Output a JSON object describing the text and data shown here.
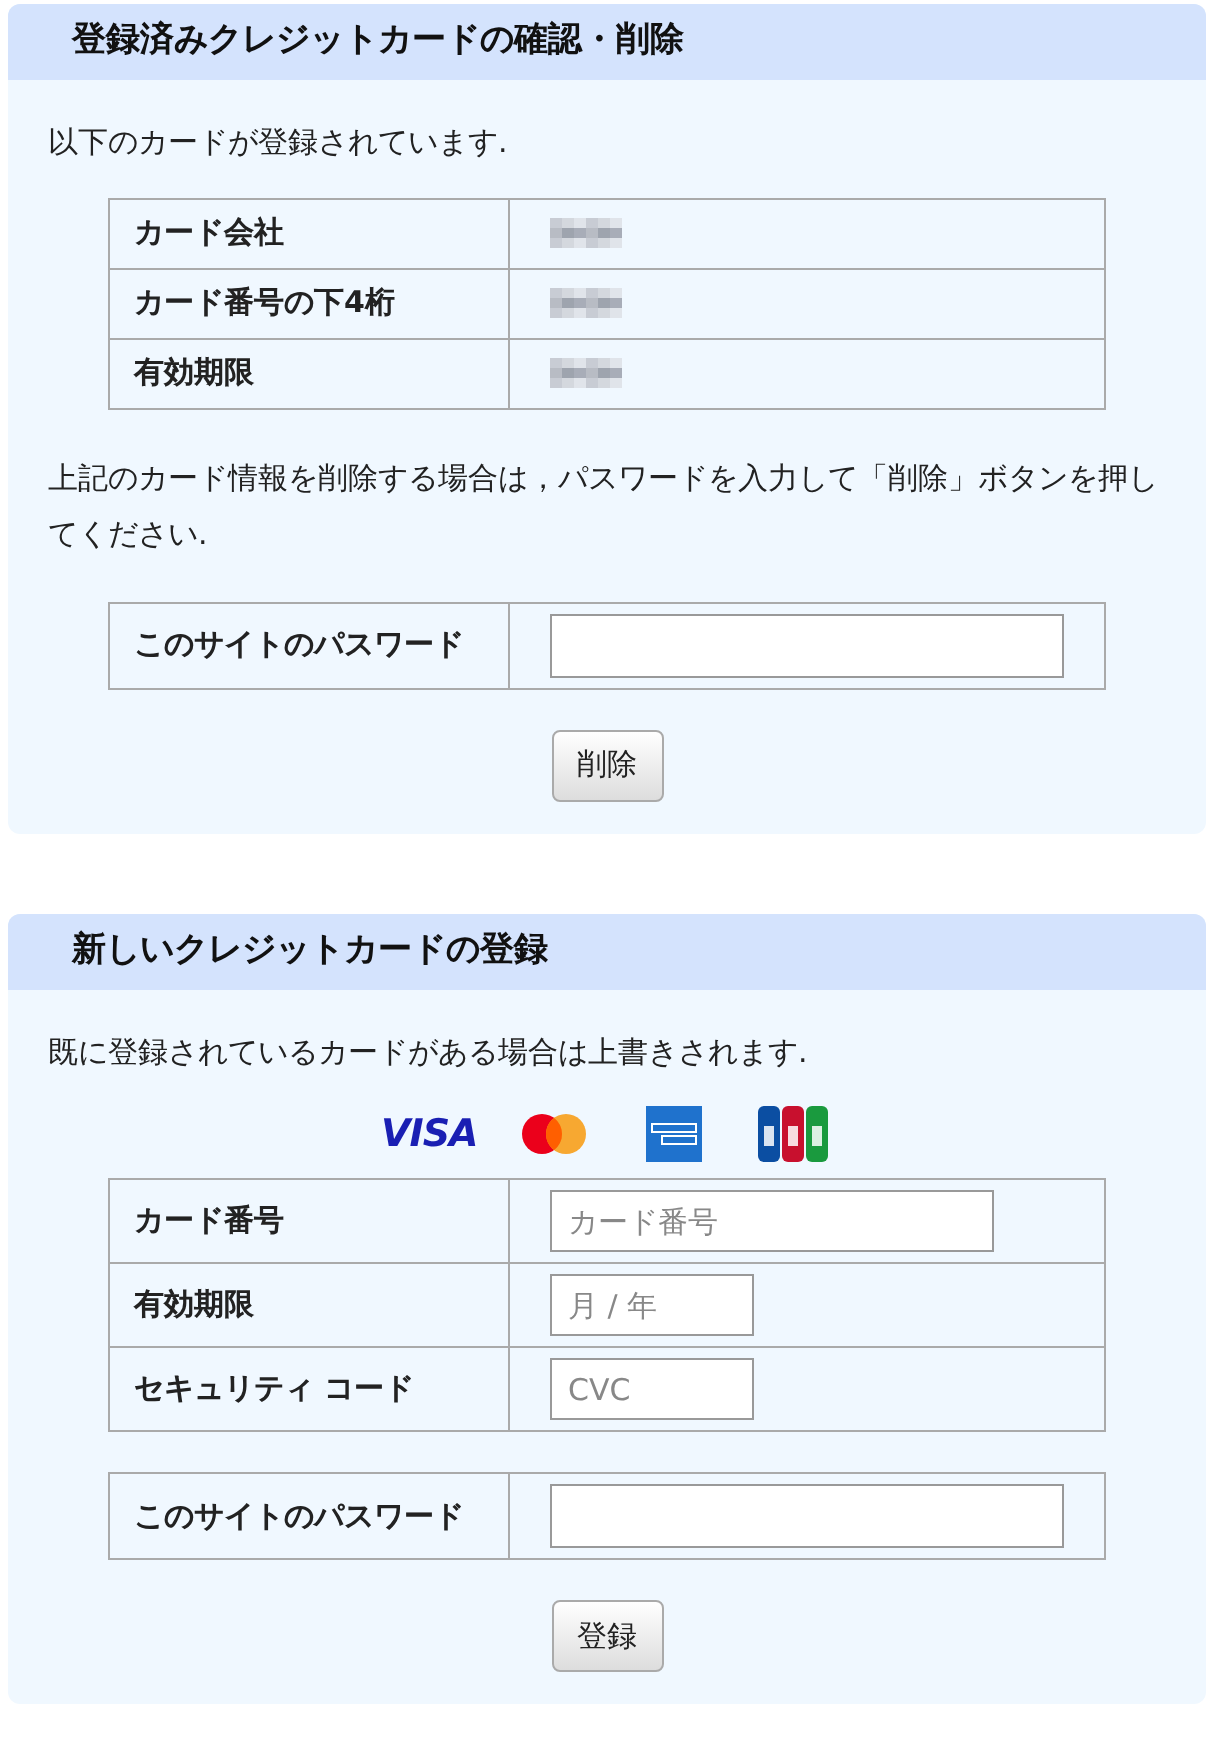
{
  "delete_section": {
    "title": "登録済みクレジットカードの確認・削除",
    "intro": "以下のカードが登録されています.",
    "card_rows": [
      {
        "label": "カード会社"
      },
      {
        "label": "カード番号の下4桁"
      },
      {
        "label": "有効期限"
      }
    ],
    "instruction": "上記のカード情報を削除する場合は，パスワードを入力して「削除」ボタンを押してください.",
    "password": {
      "label": "このサイトのパスワード"
    },
    "button": "削除"
  },
  "register_section": {
    "title": "新しいクレジットカードの登録",
    "intro": "既に登録されているカードがある場合は上書きされます.",
    "brands": [
      {
        "kind": "visa",
        "text": "VISA"
      },
      {
        "kind": "mastercard"
      },
      {
        "kind": "amex"
      },
      {
        "kind": "jcb"
      }
    ],
    "fields": [
      {
        "label": "カード番号",
        "placeholder": "カード番号",
        "kind": "wide"
      },
      {
        "label": "有効期限",
        "placeholder": "月 / 年",
        "kind": "short"
      },
      {
        "label": "セキュリティ コード",
        "placeholder": "CVC",
        "kind": "short"
      }
    ],
    "password": {
      "label": "このサイトのパスワード"
    },
    "button": "登録"
  }
}
